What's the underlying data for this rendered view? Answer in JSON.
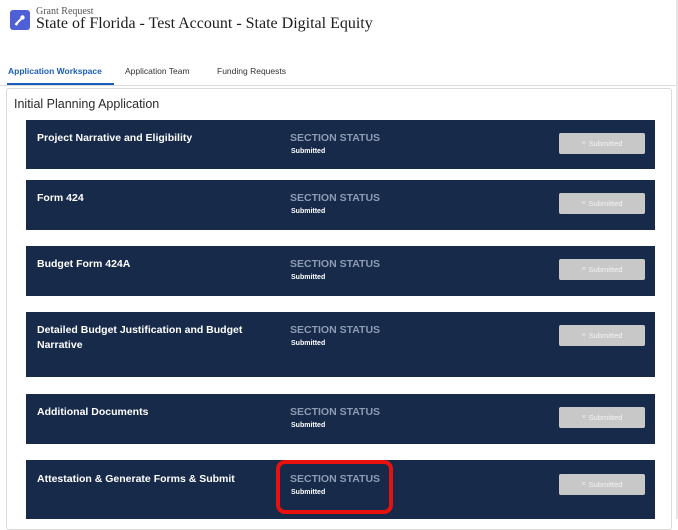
{
  "header": {
    "record_type": "Grant Request",
    "title": "State of Florida - Test Account - State Digital Equity"
  },
  "tabs": [
    {
      "label": "Application Workspace",
      "active": true
    },
    {
      "label": "Application Team",
      "active": false
    },
    {
      "label": "Funding Requests",
      "active": false
    }
  ],
  "panel": {
    "title": "Initial Planning Application"
  },
  "sections": [
    {
      "name": "Project Narrative and Eligibility",
      "status_label": "SECTION STATUS",
      "status": "Submitted",
      "button_label": "Submitted"
    },
    {
      "name": "Form 424",
      "status_label": "SECTION STATUS",
      "status": "Submitted",
      "button_label": "Submitted"
    },
    {
      "name": "Budget Form 424A",
      "status_label": "SECTION STATUS",
      "status": "Submitted",
      "button_label": "Submitted"
    },
    {
      "name": "Detailed Budget Justification and Budget Narrative",
      "status_label": "SECTION STATUS",
      "status": "Submitted",
      "button_label": "Submitted"
    },
    {
      "name": "Additional Documents",
      "status_label": "SECTION STATUS",
      "status": "Submitted",
      "button_label": "Submitted"
    },
    {
      "name": "Attestation & Generate Forms & Submit",
      "status_label": "SECTION STATUS",
      "status": "Submitted",
      "button_label": "Submitted"
    }
  ],
  "colors": {
    "section_bg": "#172a4a",
    "accent": "#1b5dbb",
    "highlight": "#e8110d",
    "button_disabled": "#c8c8c8"
  },
  "icons": {
    "app": "grant-request-icon",
    "button": "document-check-icon"
  }
}
